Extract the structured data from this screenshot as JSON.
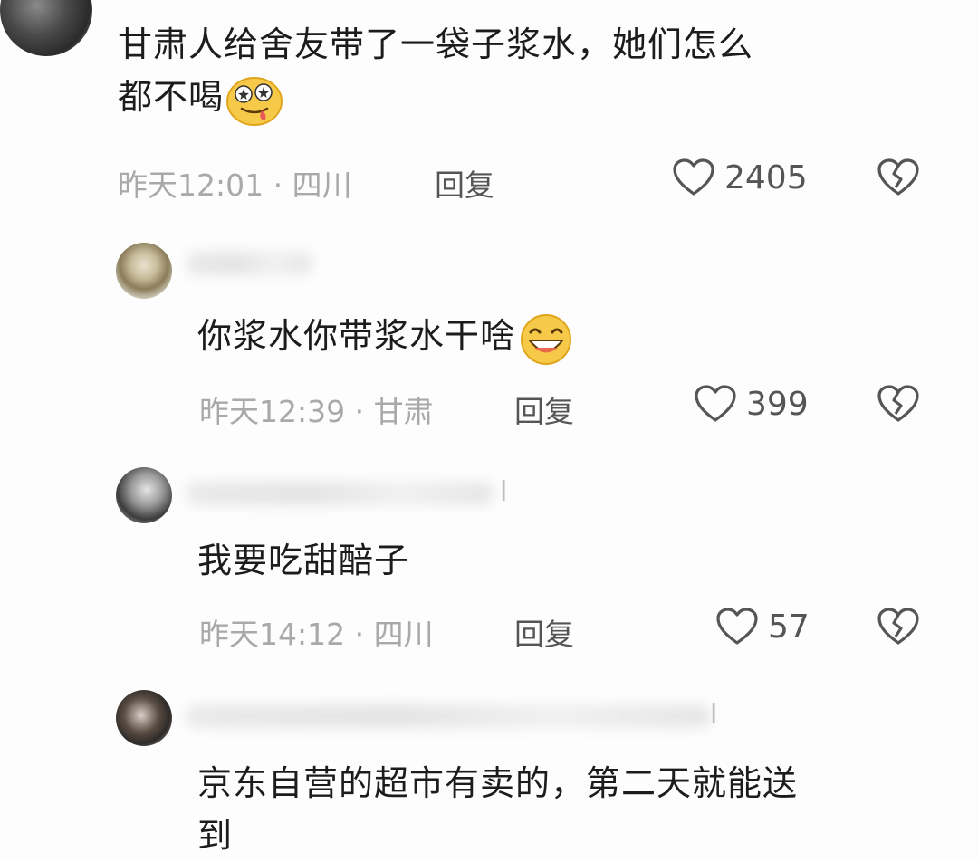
{
  "comments": [
    {
      "text_line1": "甘肃人给舍友带了一袋子浆水，她们怎么",
      "text_line2": "都不喝",
      "emoji": "drooling-star-eyes-emoji",
      "time": "昨天12:01",
      "location": "四川",
      "reply_label": "回复",
      "likes": "2405"
    },
    {
      "text": "你浆水你带浆水干啥",
      "emoji": "grinning-emoji",
      "time": "昨天12:39",
      "location": "甘肃",
      "reply_label": "回复",
      "likes": "399"
    },
    {
      "name_tail": "l",
      "text": "我要吃甜醅子",
      "time": "昨天14:12",
      "location": "四川",
      "reply_label": "回复",
      "likes": "57"
    },
    {
      "name_tail": "l",
      "text_line1": "京东自营的超市有卖的，第二天就能送",
      "text_line2": "到"
    }
  ],
  "meta_separator": "·",
  "colors": {
    "meta": "#a9a9a9",
    "text": "#1c1c1c",
    "icon": "#555555",
    "background": "#fdfdfd"
  }
}
